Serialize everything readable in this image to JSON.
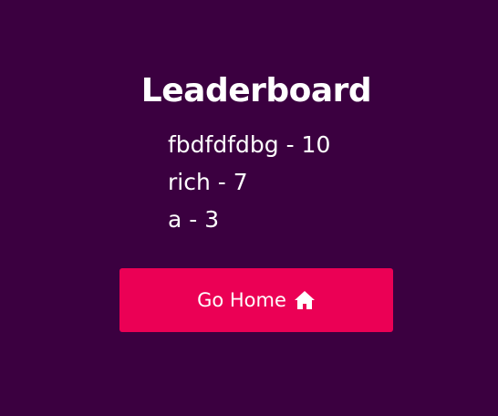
{
  "leaderboard": {
    "title": "Leaderboard",
    "entries": [
      {
        "text": "fbdfdfdbg - 10"
      },
      {
        "text": "rich - 7"
      },
      {
        "text": "a - 3"
      }
    ]
  },
  "actions": {
    "home_label": "Go Home",
    "home_icon": "home-icon"
  },
  "colors": {
    "background": "#3b0040",
    "button": "#eb0055",
    "text": "#ffffff"
  }
}
